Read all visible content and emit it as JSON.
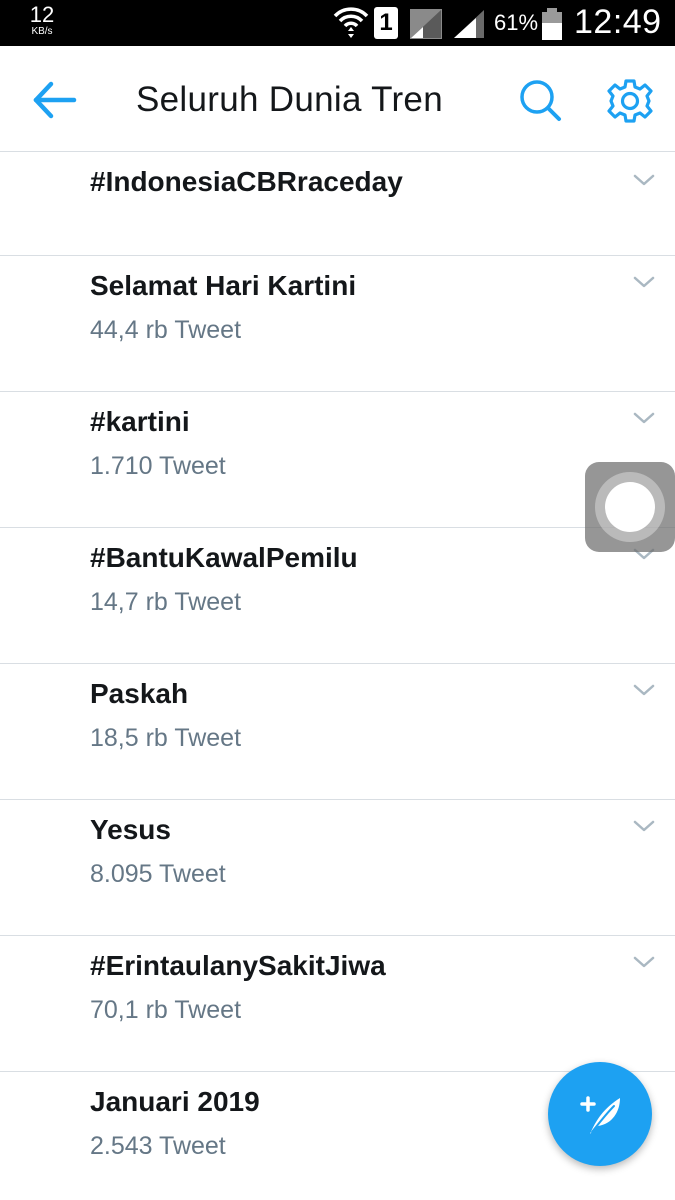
{
  "status_bar": {
    "net_speed_value": "12",
    "net_speed_unit": "KB/s",
    "sim_number": "1",
    "battery_percent": "61%",
    "time": "12:49"
  },
  "header": {
    "title": "Seluruh Dunia Tren",
    "icons": [
      "back-arrow-icon",
      "search-icon",
      "gear-icon"
    ],
    "accent_color": "#1da1f2"
  },
  "trends": [
    {
      "name": "#IndonesiaCBRraceday",
      "count": ""
    },
    {
      "name": "Selamat Hari Kartini",
      "count": "44,4 rb Tweet"
    },
    {
      "name": "#kartini",
      "count": "1.710 Tweet"
    },
    {
      "name": "#BantuKawalPemilu",
      "count": "14,7 rb Tweet"
    },
    {
      "name": "Paskah",
      "count": "18,5 rb Tweet"
    },
    {
      "name": "Yesus",
      "count": "8.095 Tweet"
    },
    {
      "name": "#ErintaulanySakitJiwa",
      "count": "70,1 rb Tweet"
    },
    {
      "name": "Januari 2019",
      "count": "2.543 Tweet"
    }
  ],
  "fab": {
    "icon": "compose-tweet-icon"
  },
  "overlay": {
    "icon": "assistive-touch-icon"
  }
}
